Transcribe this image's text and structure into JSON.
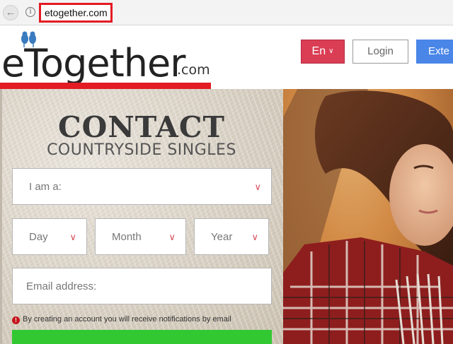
{
  "browser": {
    "back_icon": "back-arrow-icon",
    "info_icon": "info-icon",
    "url": "etogether.com",
    "url_highlight_color": "#e31b23"
  },
  "header": {
    "logo_main": "eTogether",
    "logo_suffix": ".com",
    "logo_underline_color": "#e31b23",
    "language_button": "En",
    "login_button": "Login",
    "enter_button": "Exte"
  },
  "form": {
    "title": "CONTACT",
    "subtitle": "COUNTRYSIDE SINGLES",
    "gender_select": "I am a:",
    "day_select": "Day",
    "month_select": "Month",
    "year_select": "Year",
    "email_placeholder": "Email address:",
    "notice_text": "By creating an account you will receive notifications by email",
    "submit_color": "#32c832"
  },
  "colors": {
    "language_button_bg": "#da3e54",
    "enter_button_bg": "#4a86e8",
    "chevron": "#d84a5a"
  }
}
